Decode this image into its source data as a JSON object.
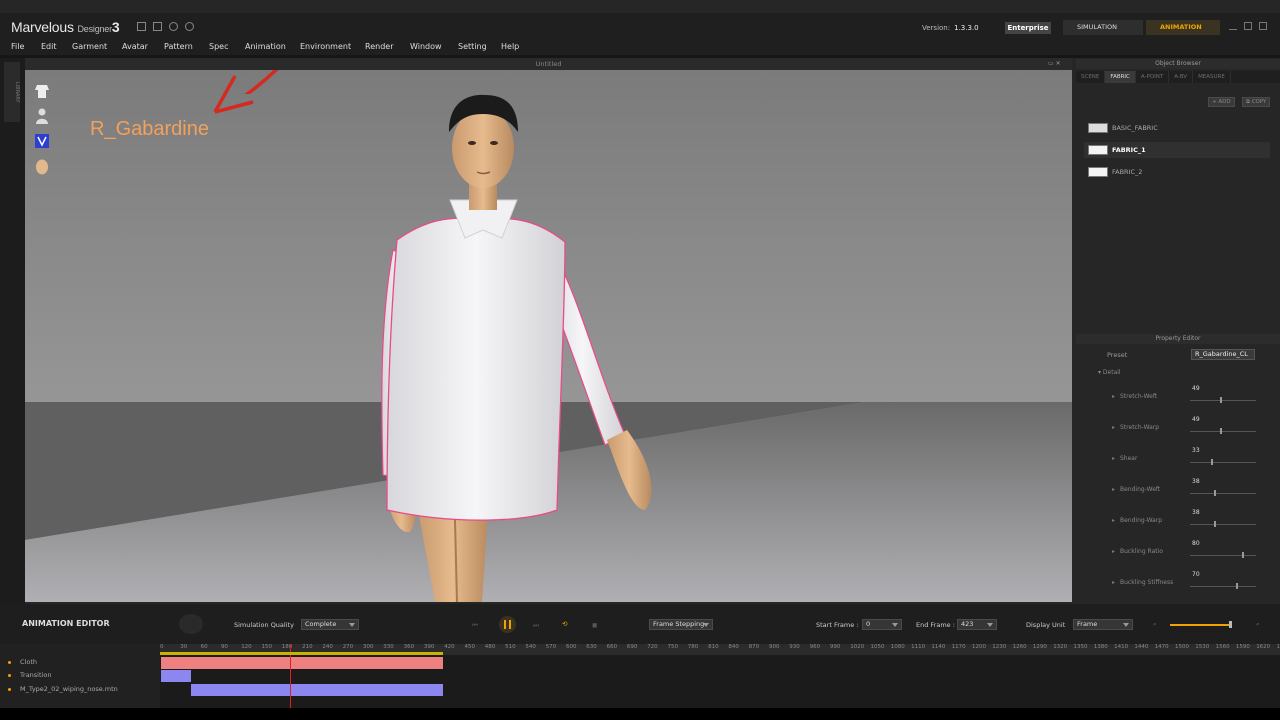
{
  "app": {
    "logo_main": "Marvelous",
    "logo_sub": "Designer",
    "logo_num": "3",
    "version_label": "Version:",
    "version_value": "1.3.3.0",
    "edition": "Enterprise",
    "mode_simulation": "SIMULATION",
    "mode_animation": "ANIMATION"
  },
  "menu": [
    "File",
    "Edit",
    "Garment",
    "Avatar",
    "Pattern",
    "Spec",
    "Animation",
    "Environment",
    "Render",
    "Window",
    "Setting",
    "Help"
  ],
  "viewport": {
    "title": "Untitled",
    "annotation": "R_Gabardine"
  },
  "left_tab": "LIBRARY",
  "object_browser": {
    "title": "Object Browser",
    "tabs": [
      "SCENE",
      "FABRIC",
      "A-POINT",
      "A-BV",
      "MEASURE"
    ],
    "active_tab": "FABRIC",
    "add_label": "ADD",
    "copy_label": "COPY",
    "fabrics": [
      "BASIC_FABRIC",
      "FABRIC_1",
      "FABRIC_2"
    ],
    "selected": "FABRIC_1"
  },
  "property_editor": {
    "title": "Property Editor",
    "preset_label": "Preset",
    "preset_value": "R_Gabardine_CL",
    "detail_label": "Detail",
    "properties": [
      {
        "label": "Stretch-Weft",
        "value": "49"
      },
      {
        "label": "Stretch-Warp",
        "value": "49"
      },
      {
        "label": "Shear",
        "value": "33"
      },
      {
        "label": "Bending-Weft",
        "value": "38"
      },
      {
        "label": "Bending-Warp",
        "value": "38"
      },
      {
        "label": "Buckling Ratio",
        "value": "80"
      },
      {
        "label": "Buckling Stiffness",
        "value": "70"
      }
    ]
  },
  "animation_editor": {
    "title": "ANIMATION EDITOR",
    "sim_quality_label": "Simulation Quality",
    "sim_quality_value": "Complete",
    "frame_stepping": "Frame Stepping",
    "start_frame_label": "Start Frame :",
    "start_frame_value": "0",
    "end_frame_label": "End Frame :",
    "end_frame_value": "423",
    "display_unit_label": "Display Unit",
    "display_unit_value": "Frame"
  },
  "timeline": {
    "ticks": [
      "0",
      "30",
      "60",
      "90",
      "120",
      "150",
      "180",
      "210",
      "240",
      "270",
      "300",
      "330",
      "360",
      "390",
      "420",
      "450",
      "480",
      "510",
      "540",
      "570",
      "600",
      "630",
      "660",
      "690",
      "720",
      "750",
      "780",
      "810",
      "840",
      "870",
      "900",
      "930",
      "960",
      "990",
      "1020",
      "1050",
      "1080",
      "1110",
      "1140",
      "1170",
      "1200",
      "1230",
      "1260",
      "1290",
      "1320",
      "1350",
      "1380",
      "1410",
      "1440",
      "1470",
      "1500",
      "1530",
      "1560",
      "1590",
      "1620",
      "1650"
    ],
    "tracks": [
      "Cloth",
      "Transition",
      "M_Type2_02_wiping_nose.mtn"
    ],
    "colors": {
      "cloth": "#ef8080",
      "motion": "#8c86f0",
      "playhead": "#e02020",
      "accent": "#f2a200"
    }
  }
}
